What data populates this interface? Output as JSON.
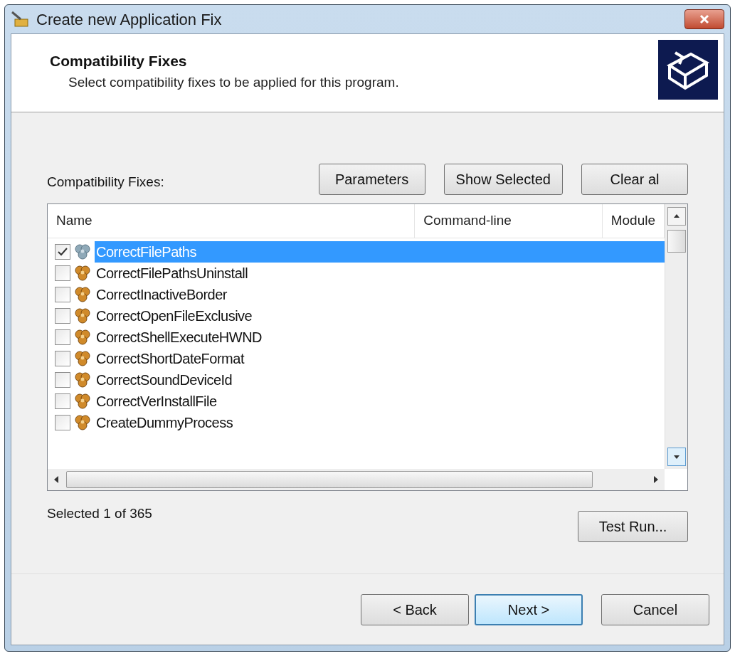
{
  "window": {
    "title": "Create new Application Fix"
  },
  "header": {
    "title": "Compatibility Fixes",
    "subtitle": "Select compatibility fixes to be applied for this program."
  },
  "fixes_label": "Compatibility Fixes:",
  "toolbar_buttons": [
    "Parameters",
    "Show Selected",
    "Clear al"
  ],
  "list": {
    "columns": [
      "Name",
      "Command-line",
      "Module"
    ],
    "rows": [
      {
        "name": "CorrectFilePaths",
        "checked": true,
        "selected": true
      },
      {
        "name": "CorrectFilePathsUninstall",
        "checked": false,
        "selected": false
      },
      {
        "name": "CorrectInactiveBorder",
        "checked": false,
        "selected": false
      },
      {
        "name": "CorrectOpenFileExclusive",
        "checked": false,
        "selected": false
      },
      {
        "name": "CorrectShellExecuteHWND",
        "checked": false,
        "selected": false
      },
      {
        "name": "CorrectShortDateFormat",
        "checked": false,
        "selected": false
      },
      {
        "name": "CorrectSoundDeviceId",
        "checked": false,
        "selected": false
      },
      {
        "name": "CorrectVerInstallFile",
        "checked": false,
        "selected": false
      },
      {
        "name": "CreateDummyProcess",
        "checked": false,
        "selected": false
      }
    ]
  },
  "status": "Selected 1 of 365",
  "test_run": "Test Run...",
  "footer_buttons": [
    {
      "label": "< Back",
      "default": false
    },
    {
      "label": "Next >",
      "default": true
    },
    {
      "label": "Cancel",
      "default": false
    }
  ]
}
